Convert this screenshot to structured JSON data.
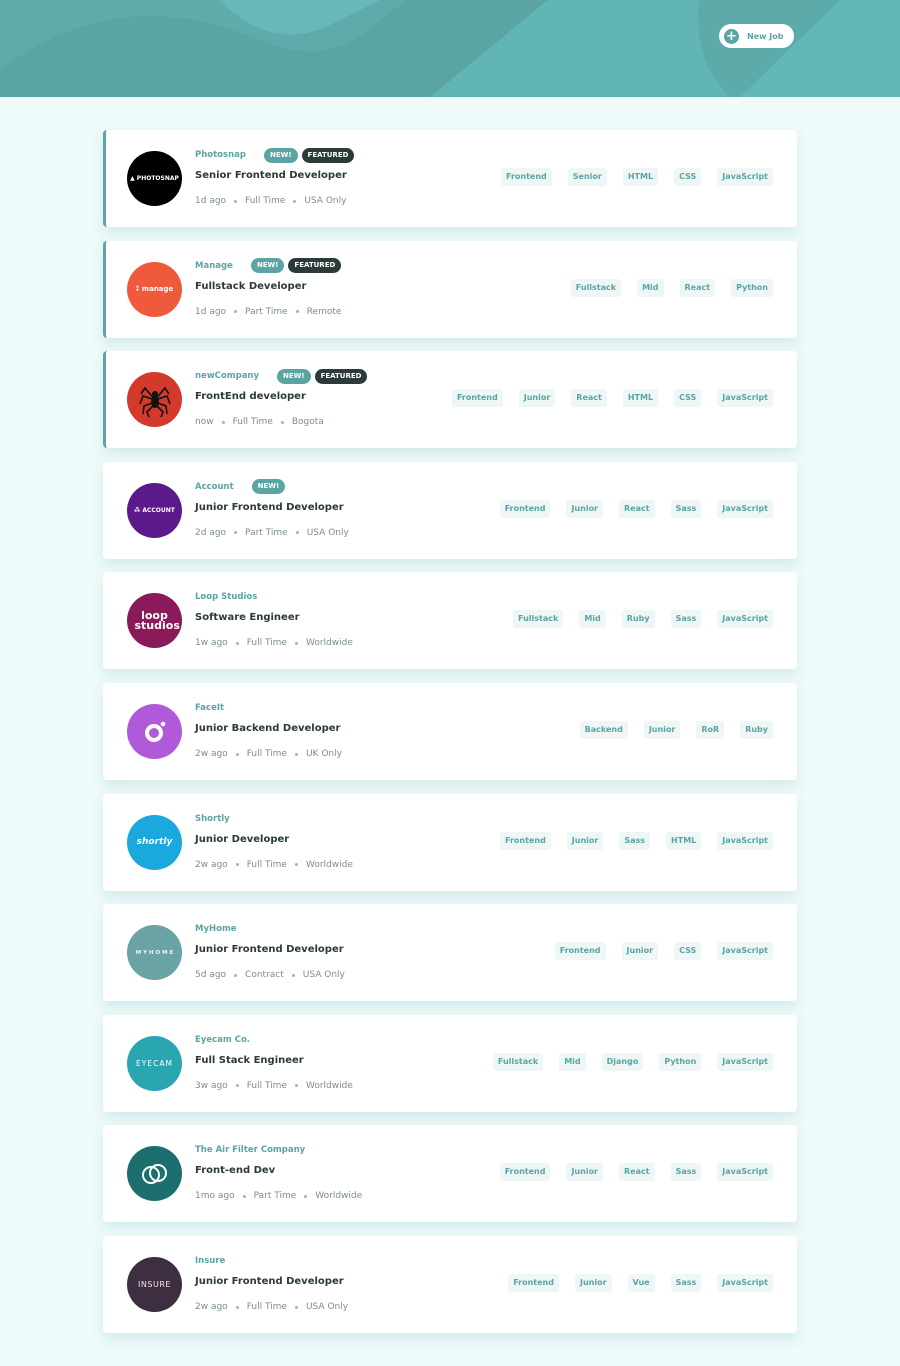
{
  "header": {
    "new_job_label": "New Job",
    "color": "#5ba4a4"
  },
  "jobs": [
    {
      "company": "Photosnap",
      "logo_text": "▲ PHOTOSNAP",
      "logo_bg": "#000000",
      "new": true,
      "featured": true,
      "position": "Senior Frontend Developer",
      "posted": "1d ago",
      "contract": "Full Time",
      "location": "USA Only",
      "tags": [
        "Frontend",
        "Senior",
        "HTML",
        "CSS",
        "JavaScript"
      ]
    },
    {
      "company": "Manage",
      "logo_text": "⁑ manage",
      "logo_bg": "#f05a3c",
      "new": true,
      "featured": true,
      "position": "Fullstack Developer",
      "posted": "1d ago",
      "contract": "Part Time",
      "location": "Remote",
      "tags": [
        "Fullstack",
        "Mid",
        "React",
        "Python"
      ]
    },
    {
      "company": "newCompany",
      "logo_text": "",
      "logo_bg": "#d33a2c",
      "new": true,
      "featured": true,
      "position": "FrontEnd developer",
      "posted": "now",
      "contract": "Full Time",
      "location": "Bogota",
      "tags": [
        "Frontend",
        "Junior",
        "React",
        "HTML",
        "CSS",
        "JavaScript"
      ]
    },
    {
      "company": "Account",
      "logo_text": "⁂ ACCOUNT",
      "logo_bg": "#5a1a8b",
      "new": true,
      "featured": false,
      "position": "Junior Frontend Developer",
      "posted": "2d ago",
      "contract": "Part Time",
      "location": "USA Only",
      "tags": [
        "Frontend",
        "Junior",
        "React",
        "Sass",
        "JavaScript"
      ]
    },
    {
      "company": "Loop Studios",
      "logo_text": "loop studios",
      "logo_bg": "#8b1a5a",
      "new": false,
      "featured": false,
      "position": "Software Engineer",
      "posted": "1w ago",
      "contract": "Full Time",
      "location": "Worldwide",
      "tags": [
        "Fullstack",
        "Mid",
        "Ruby",
        "Sass",
        "JavaScript"
      ]
    },
    {
      "company": "FaceIt",
      "logo_text": "",
      "logo_bg": "#b05ad9",
      "new": false,
      "featured": false,
      "position": "Junior Backend Developer",
      "posted": "2w ago",
      "contract": "Full Time",
      "location": "UK Only",
      "tags": [
        "Backend",
        "Junior",
        "RoR",
        "Ruby"
      ]
    },
    {
      "company": "Shortly",
      "logo_text": "shortly",
      "logo_bg": "#1ba8dc",
      "new": false,
      "featured": false,
      "position": "Junior Developer",
      "posted": "2w ago",
      "contract": "Full Time",
      "location": "Worldwide",
      "tags": [
        "Frontend",
        "Junior",
        "Sass",
        "HTML",
        "JavaScript"
      ]
    },
    {
      "company": "MyHome",
      "logo_text": "M Y H O M E",
      "logo_bg": "#6aa3a3",
      "new": false,
      "featured": false,
      "position": "Junior Frontend Developer",
      "posted": "5d ago",
      "contract": "Contract",
      "location": "USA Only",
      "tags": [
        "Frontend",
        "Junior",
        "CSS",
        "JavaScript"
      ]
    },
    {
      "company": "Eyecam Co.",
      "logo_text": "EYECAM",
      "logo_bg": "#2aa6b3",
      "new": false,
      "featured": false,
      "position": "Full Stack Engineer",
      "posted": "3w ago",
      "contract": "Full Time",
      "location": "Worldwide",
      "tags": [
        "Fullstack",
        "Mid",
        "Django",
        "Python",
        "JavaScript"
      ]
    },
    {
      "company": "The Air Filter Company",
      "logo_text": "",
      "logo_bg": "#1d6e6e",
      "new": false,
      "featured": false,
      "position": "Front-end Dev",
      "posted": "1mo ago",
      "contract": "Part Time",
      "location": "Worldwide",
      "tags": [
        "Frontend",
        "Junior",
        "React",
        "Sass",
        "JavaScript"
      ]
    },
    {
      "company": "Insure",
      "logo_text": "INSURE",
      "logo_bg": "#3d2e42",
      "new": false,
      "featured": false,
      "position": "Junior Frontend Developer",
      "posted": "2w ago",
      "contract": "Full Time",
      "location": "USA Only",
      "tags": [
        "Frontend",
        "Junior",
        "Vue",
        "Sass",
        "JavaScript"
      ]
    }
  ],
  "labels": {
    "new": "NEW!",
    "featured": "FEATURED"
  },
  "colors": {
    "accent": "#5ba4a4",
    "dark": "#2c3a3a",
    "background": "#effafa",
    "tag_bg": "#eef6f6"
  }
}
